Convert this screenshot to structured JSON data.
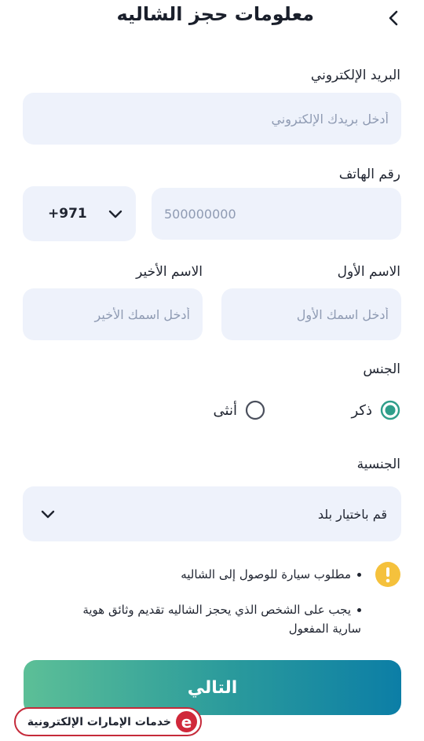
{
  "header": {
    "title": "معلومات حجز الشاليه",
    "back_icon": "chevron-left-icon"
  },
  "form": {
    "email": {
      "label": "البريد الإلكتروني",
      "placeholder": "أدخل بريدك الإلكتروني",
      "value": ""
    },
    "phone": {
      "label": "رقم الهاتف",
      "country_code": "+971",
      "placeholder": "500000000",
      "value": ""
    },
    "first_name": {
      "label": "الاسم الأول",
      "placeholder": "أدخل اسمك الأول",
      "value": ""
    },
    "last_name": {
      "label": "الاسم الأخير",
      "placeholder": "أدخل اسمك الأخير",
      "value": ""
    },
    "gender": {
      "label": "الجنس",
      "options": [
        {
          "label": "ذكر",
          "selected": true
        },
        {
          "label": "أنثى",
          "selected": false
        }
      ]
    },
    "nationality": {
      "label": "الجنسية",
      "selected": "قم باختيار بلد"
    }
  },
  "notes": {
    "icon": "warning-icon",
    "items": [
      "مطلوب سيارة للوصول إلى الشاليه",
      "يجب على الشخص الذي يحجز الشاليه تقديم وثائق هوية سارية المفعول"
    ]
  },
  "actions": {
    "next_label": "التالي"
  },
  "watermark": {
    "text": "خدمات الإمارات الإلكترونية",
    "logo_letter": "e"
  },
  "colors": {
    "field_bg": "#eef2fb",
    "accent_green": "#2f9e8a",
    "warning_yellow": "#f5c13c",
    "button_gradient_start": "#5cbf97",
    "button_gradient_end": "#0c7ea6",
    "brand_red": "#d0283a"
  }
}
